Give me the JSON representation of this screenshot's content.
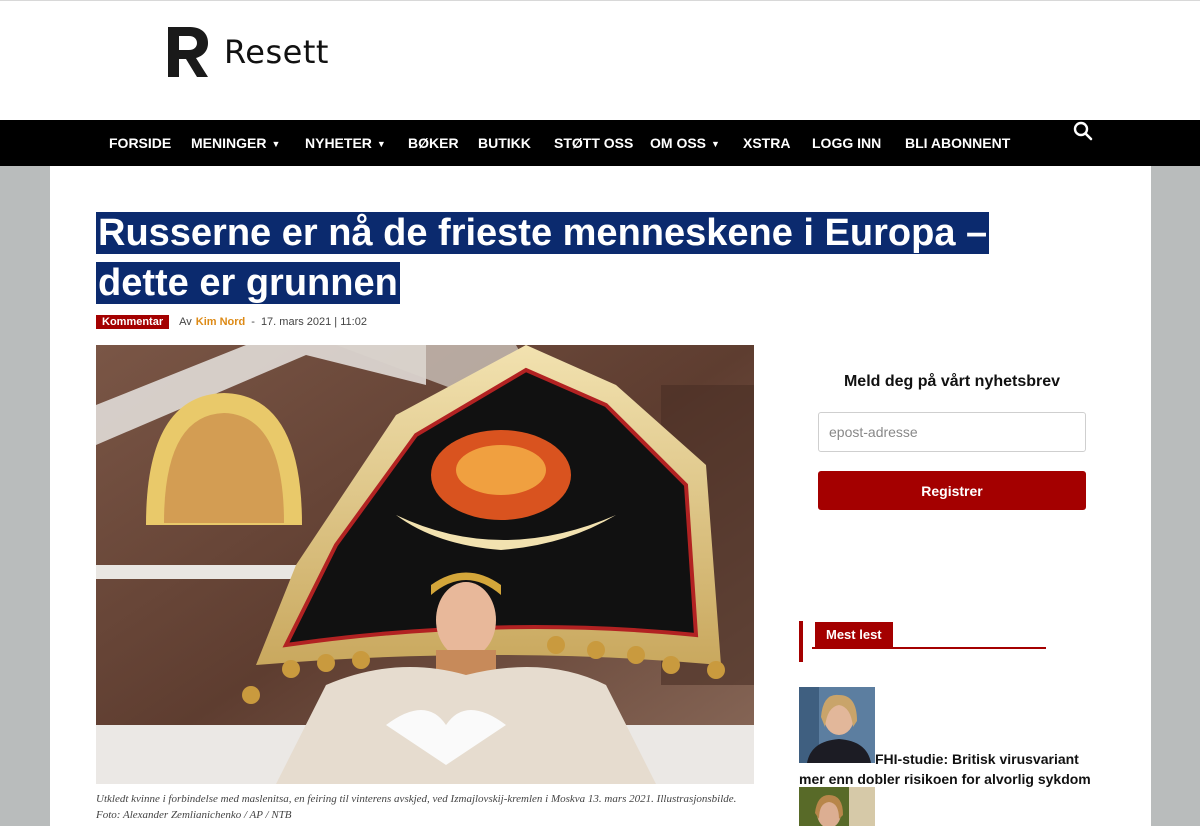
{
  "site": {
    "name": "Resett"
  },
  "nav": {
    "items": [
      {
        "label": "FORSIDE"
      },
      {
        "label": "MENINGER"
      },
      {
        "label": "NYHETER"
      },
      {
        "label": "BØKER"
      },
      {
        "label": "BUTIKK"
      },
      {
        "label": "STØTT OSS"
      },
      {
        "label": "OM OSS"
      },
      {
        "label": "XSTRA"
      },
      {
        "label": "LOGG INN"
      },
      {
        "label": "BLI ABONNENT"
      }
    ],
    "search_icon": "search-icon"
  },
  "article": {
    "title": "Russerne er nå de frieste menneskene i Europa – dette er grunnen",
    "category": "Kommentar",
    "by_prefix": "Av",
    "author": "Kim Nord",
    "separator": "-",
    "date": "17. mars 2021 | 11:02",
    "caption": "Utkledt kvinne i forbindelse med maslenitsa, en feiring til vinterens avskjed, ved Izmajlovskij-kremlen i Moskva 13. mars 2021. Illustrasjonsbilde. Foto: Alexander Zemlianichenko / AP / NTB"
  },
  "newsletter": {
    "title": "Meld deg på vårt nyhetsbrev",
    "email_placeholder": "epost-adresse",
    "button_label": "Registrer"
  },
  "most_read": {
    "tab_label": "Mest lest",
    "items": [
      {
        "title": "FHI-studie: Britisk virusvariant mer enn dobler risikoen for alvorlig sykdom"
      }
    ]
  },
  "colors": {
    "accent": "#a40000",
    "title_highlight": "#0b2a6e",
    "author": "#dd8a16",
    "nav_bg": "#000000"
  }
}
